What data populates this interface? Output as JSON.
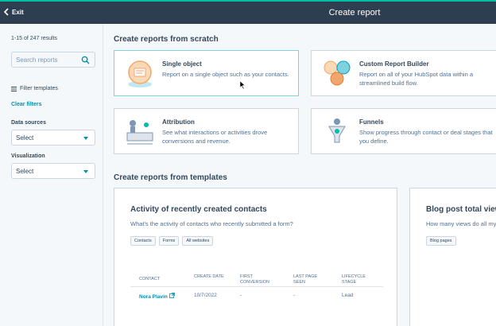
{
  "topbar": {
    "exit_label": "Exit",
    "title": "Create report"
  },
  "sidebar": {
    "results": "1-15 of 247 results",
    "search_placeholder": "Search reports",
    "filter_label": "Filter templates",
    "clear_label": "Clear filters",
    "data_sources_label": "Data sources",
    "data_sources_value": "Select",
    "visualization_label": "Visualization",
    "visualization_value": "Select"
  },
  "scratch": {
    "heading": "Create reports from scratch",
    "cards": [
      {
        "title": "Single object",
        "desc": "Report on a single object such as your contacts."
      },
      {
        "title": "Custom Report Builder",
        "desc": "Report on all of your HubSpot data within a streamlined build flow."
      },
      {
        "title": "Attribution",
        "desc": "See what interactions or activities drove conversions and revenue."
      },
      {
        "title": "Funnels",
        "desc": "Show progress through contact or deal stages that you define."
      }
    ]
  },
  "templates": {
    "heading": "Create reports from templates",
    "cards": [
      {
        "title": "Activity of recently created contacts",
        "desc": "What's the activity of contacts who recently submitted a form?",
        "tags": [
          "Contacts",
          "Forms",
          "All websites"
        ],
        "columns": [
          "CONTACT",
          "CREATE DATE",
          "FIRST CONVERSION",
          "LAST PAGE SEEN",
          "LIFECYCLE STAGE"
        ],
        "row": {
          "contact": "Nora Plavin",
          "create_date": "10/7/2022",
          "first_conversion": "-",
          "last_page_seen": "-",
          "lifecycle_stage": "Lead"
        }
      },
      {
        "title": "Blog post total views",
        "desc": "How many views do all my",
        "tags": [
          "Blog pages"
        ]
      }
    ]
  },
  "colors": {
    "topbar": "#2d3e50",
    "accent": "#00bda5",
    "link": "#0091ae"
  }
}
